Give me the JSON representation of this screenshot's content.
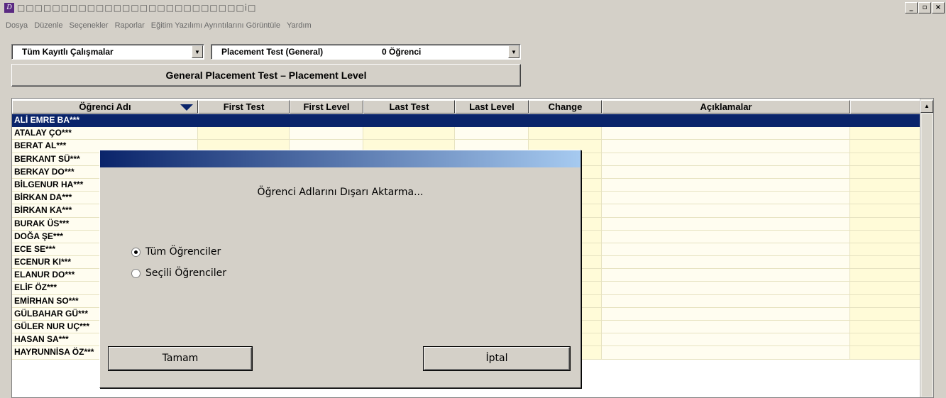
{
  "window": {
    "app_icon_glyph": "D",
    "title": "□□□□□□□□□□□□□□□□□□□□□□□□□□i□",
    "controls": [
      "_",
      "▫",
      "×"
    ]
  },
  "menu": [
    "Dosya",
    "Düzenle",
    "Seçenekler",
    "Raporlar",
    "Eğitim Yazılımı Ayrıntılarını Görüntüle",
    "Yardım"
  ],
  "filters": {
    "group": "Tüm Kayıtlı Çalışmalar",
    "test": "Placement Test (General)",
    "count": "0 Öğrenci"
  },
  "header_title": "General Placement Test  –  Placement Level",
  "columns": [
    "Öğrenci Adı",
    "First Test",
    "First Level",
    "Last Test",
    "Last Level",
    "Change",
    "Açıklamalar",
    ""
  ],
  "students": [
    "ALİ EMRE BA***",
    "ATALAY ÇO***",
    "BERAT AL***",
    "BERKANT SÜ***",
    "BERKAY DO***",
    "BİLGENUR HA***",
    "BİRKAN DA***",
    "BİRKAN KA***",
    "BURAK ÜS***",
    "DOĞA ŞE***",
    "ECE SE***",
    "ECENUR KI***",
    "ELANUR DO***",
    "ELİF ÖZ***",
    "EMİRHAN SO***",
    "GÜLBAHAR GÜ***",
    "GÜLER NUR UÇ***",
    "HASAN SA***",
    "HAYRUNNİSA ÖZ***"
  ],
  "selected_index": 0,
  "dialog": {
    "message": "Öğrenci Adlarını Dışarı Aktarma...",
    "options": [
      {
        "label": "Tüm Öğrenciler",
        "checked": true
      },
      {
        "label": "Seçili Öğrenciler",
        "checked": false
      }
    ],
    "ok": "Tamam",
    "cancel": "İptal"
  },
  "colors": {
    "selection": "#0a246a",
    "row_yellow": "#fffbd8",
    "face": "#d4d0c8"
  }
}
